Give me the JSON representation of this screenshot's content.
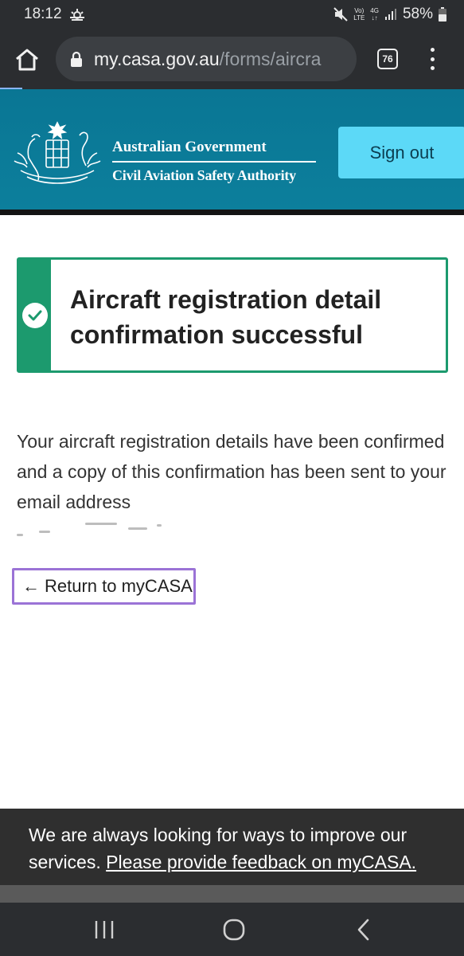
{
  "status_bar": {
    "time": "18:12",
    "volte_top": "Vo)",
    "volte_bottom": "LTE",
    "net_top": "4G",
    "net_bottom": "↓↑",
    "battery": "58%",
    "icons": [
      "weather-icon",
      "mute-icon",
      "signal-icon",
      "battery-icon"
    ]
  },
  "browser": {
    "url_host": "my.casa.gov.au",
    "url_path": "/forms/aircra",
    "tab_count": "76"
  },
  "header": {
    "gov_title": "Australian Government",
    "agency_title": "Civil Aviation Safety Authority",
    "sign_out_label": "Sign out"
  },
  "notice": {
    "title": "Aircraft registration detail confirmation successful"
  },
  "main": {
    "message": "Your aircraft registration details have been confirmed and a copy of this confirmation has been sent to your email address",
    "return_label": "Return to myCASA",
    "return_arrow": "←"
  },
  "feedback": {
    "text": "We are always looking for ways to improve our services.",
    "link_label": "Please provide feedback on myCASA."
  },
  "colors": {
    "header_bg": "#0a7694",
    "sign_out_bg": "#5cd9f7",
    "success_green": "#1c9a6e",
    "focus_purple": "#9b73d6",
    "feedback_bg": "#2f2f2f"
  }
}
